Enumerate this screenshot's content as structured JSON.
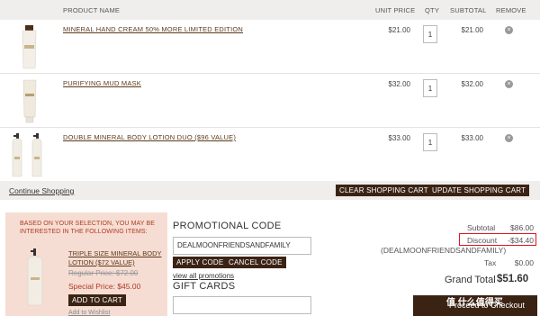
{
  "table": {
    "headers": {
      "product": "PRODUCT NAME",
      "unit_price": "UNIT PRICE",
      "qty": "QTY",
      "subtotal": "SUBTOTAL",
      "remove": "REMOVE"
    },
    "items": [
      {
        "name": "MINERAL HAND CREAM 50% MORE LIMITED EDITION",
        "unit_price": "$21.00",
        "qty": "1",
        "subtotal": "$21.00"
      },
      {
        "name": "PURIFYING MUD MASK",
        "unit_price": "$32.00",
        "qty": "1",
        "subtotal": "$32.00"
      },
      {
        "name": "DOUBLE MINERAL BODY LOTION DUO ($96 VALUE)",
        "unit_price": "$33.00",
        "qty": "1",
        "subtotal": "$33.00"
      }
    ]
  },
  "actions": {
    "continue": "Continue Shopping",
    "clear": "CLEAR SHOPPING CART",
    "update": "UPDATE SHOPPING CART"
  },
  "promo_suggest": {
    "title": "BASED ON YOUR SELECTION, YOU MAY BE INTERESTED IN THE FOLLOWING ITEMS:",
    "product": "TRIPLE SIZE MINERAL BODY LOTION ($72 VALUE)",
    "regular": "Regular Price: $72.00",
    "special": "Special Price: $45.00",
    "add_to_cart": "ADD TO CART",
    "wishlist": "Add to Wishlist"
  },
  "promo_code": {
    "title": "PROMOTIONAL CODE",
    "value": "DEALMOONFRIENDSANDFAMILY",
    "apply": "APPLY CODE",
    "cancel": "CANCEL CODE",
    "view_all": "view all promotions"
  },
  "gift_cards": {
    "title": "GIFT CARDS"
  },
  "summary": {
    "subtotal_label": "Subtotal",
    "subtotal": "$86.00",
    "discount_label": "Discount",
    "discount": "-$34.40",
    "discount_code": "(DEALMOONFRIENDSANDFAMILY)",
    "tax_label": "Tax",
    "tax": "$0.00",
    "grand_label": "Grand Total",
    "grand": "$51.60",
    "checkout": "Proceed to Checkout"
  },
  "watermark": "值 什么值得买",
  "colors": {
    "brand_dark": "#3b2314",
    "accent_red": "#e0141e",
    "promo_bg": "#f6ddd3"
  }
}
